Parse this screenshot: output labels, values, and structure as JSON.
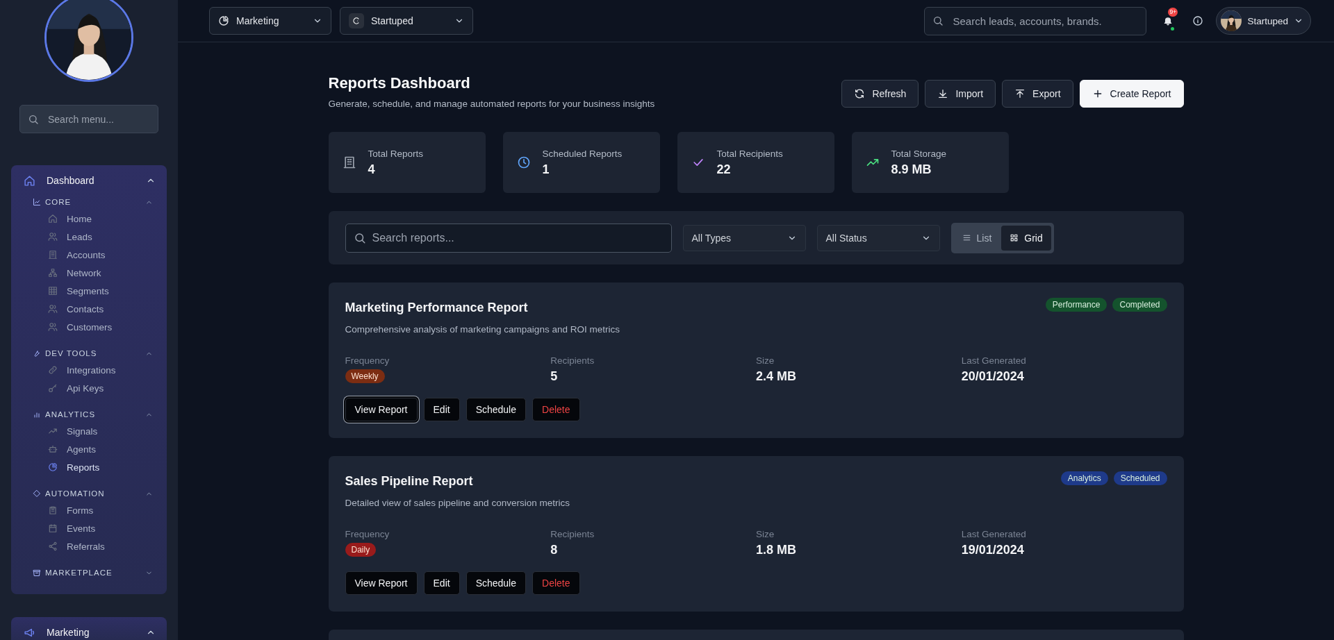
{
  "sidebar": {
    "search": {
      "placeholder": "Search menu..."
    },
    "nav": [
      {
        "label": "Dashboard",
        "expanded": true,
        "groups": [
          {
            "label": "CORE",
            "expanded": true,
            "items": [
              {
                "label": "Home",
                "selected": false
              },
              {
                "label": "Leads",
                "selected": false
              },
              {
                "label": "Accounts",
                "selected": false
              },
              {
                "label": "Network",
                "selected": false
              },
              {
                "label": "Segments",
                "selected": false
              },
              {
                "label": "Contacts",
                "selected": false
              },
              {
                "label": "Customers",
                "selected": false
              }
            ]
          },
          {
            "label": "DEV TOOLS",
            "expanded": true,
            "items": [
              {
                "label": "Integrations",
                "selected": false
              },
              {
                "label": "Api Keys",
                "selected": false
              }
            ]
          },
          {
            "label": "ANALYTICS",
            "expanded": true,
            "items": [
              {
                "label": "Signals",
                "selected": false
              },
              {
                "label": "Agents",
                "selected": false
              },
              {
                "label": "Reports",
                "selected": true
              }
            ]
          },
          {
            "label": "AUTOMATION",
            "expanded": true,
            "items": [
              {
                "label": "Forms",
                "selected": false
              },
              {
                "label": "Events",
                "selected": false
              },
              {
                "label": "Referrals",
                "selected": false
              }
            ]
          },
          {
            "label": "MARKETPLACE",
            "expanded": false
          }
        ]
      },
      {
        "label": "Marketing",
        "expanded": true
      }
    ]
  },
  "top_bar": {
    "workspace": "Marketing",
    "brand": "Startuped",
    "search": {
      "placeholder": "Search leads, accounts, brands."
    },
    "notifications": "9+",
    "user": "Startuped"
  },
  "header": {
    "title": "Reports Dashboard",
    "subtitle": "Generate, schedule, and manage automated reports for your business insights",
    "actions": [
      {
        "label": "Refresh",
        "kind": "refresh",
        "primary": false
      },
      {
        "label": "Import",
        "kind": "import",
        "primary": false
      },
      {
        "label": "Export",
        "kind": "export",
        "primary": false
      },
      {
        "label": "Create Report",
        "kind": "create",
        "primary": true
      }
    ]
  },
  "stats": [
    {
      "label": "Total Reports",
      "value": "4",
      "kind": "reports"
    },
    {
      "label": "Scheduled Reports",
      "value": "1",
      "kind": "scheduled"
    },
    {
      "label": "Total Recipients",
      "value": "22",
      "kind": "recipients"
    },
    {
      "label": "Total Storage",
      "value": "8.9 MB",
      "kind": "storage"
    }
  ],
  "filters": {
    "search": {
      "placeholder": "Search reports..."
    },
    "dropdowns": [
      "All Types",
      "All Status"
    ],
    "view": [
      {
        "label": "List",
        "kind": "list",
        "selected": false
      },
      {
        "label": "Grid",
        "kind": "grid",
        "selected": true
      }
    ]
  },
  "reports": [
    {
      "title": "Marketing Performance Report",
      "description": "Comprehensive analysis of marketing campaigns and ROI metrics",
      "tags": [
        {
          "label": "Performance",
          "color": "#14532d"
        },
        {
          "label": "Completed",
          "color": "#14532d"
        }
      ],
      "details": [
        {
          "label": "Frequency",
          "value": "Weekly",
          "kind": "badge",
          "color": "#7c2d12"
        },
        {
          "label": "Recipients",
          "value": "5",
          "kind": "text"
        },
        {
          "label": "Size",
          "value": "2.4 MB",
          "kind": "text"
        },
        {
          "label": "Last Generated",
          "value": "20/01/2024",
          "kind": "text"
        }
      ],
      "actions": [
        {
          "label": "View Report",
          "kind": "view",
          "focused": true
        },
        {
          "label": "Edit",
          "kind": "edit",
          "focused": false
        },
        {
          "label": "Schedule",
          "kind": "schedule",
          "focused": false
        },
        {
          "label": "Delete",
          "kind": "delete",
          "focused": false
        }
      ]
    },
    {
      "title": "Sales Pipeline Report",
      "description": "Detailed view of sales pipeline and conversion metrics",
      "tags": [
        {
          "label": "Analytics",
          "color": "#1e3a8a"
        },
        {
          "label": "Scheduled",
          "color": "#1e3a8a"
        }
      ],
      "details": [
        {
          "label": "Frequency",
          "value": "Daily",
          "kind": "badge",
          "color": "#991b1b"
        },
        {
          "label": "Recipients",
          "value": "8",
          "kind": "text"
        },
        {
          "label": "Size",
          "value": "1.8 MB",
          "kind": "text"
        },
        {
          "label": "Last Generated",
          "value": "19/01/2024",
          "kind": "text"
        }
      ],
      "actions": [
        {
          "label": "View Report",
          "kind": "view",
          "focused": false
        },
        {
          "label": "Edit",
          "kind": "edit",
          "focused": false
        },
        {
          "label": "Schedule",
          "kind": "schedule",
          "focused": false
        },
        {
          "label": "Delete",
          "kind": "delete",
          "focused": false
        }
      ]
    }
  ]
}
